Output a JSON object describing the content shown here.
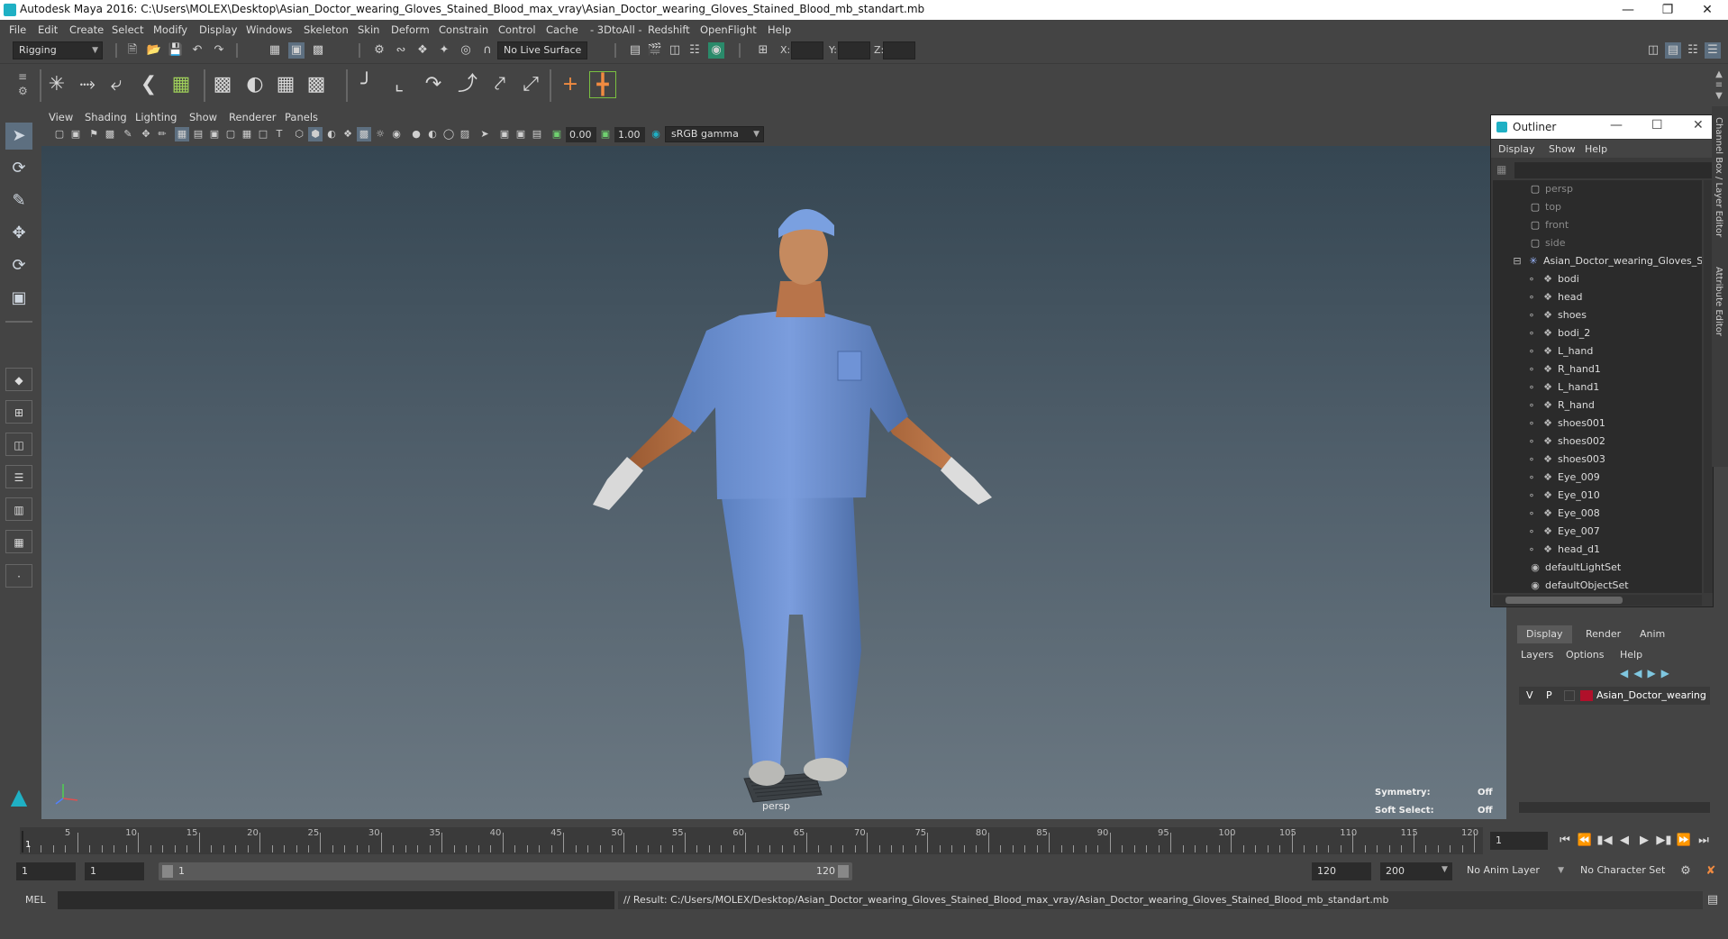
{
  "window": {
    "title": "Autodesk Maya 2016: C:\\Users\\MOLEX\\Desktop\\Asian_Doctor_wearing_Gloves_Stained_Blood_max_vray\\Asian_Doctor_wearing_Gloves_Stained_Blood_mb_standart.mb"
  },
  "menu": [
    "File",
    "Edit",
    "Create",
    "Select",
    "Modify",
    "Display",
    "Windows",
    "Skeleton",
    "Skin",
    "Deform",
    "Constrain",
    "Control",
    "Cache",
    "- 3DtoAll -",
    "Redshift",
    "OpenFlight",
    "Help"
  ],
  "statusline": {
    "menuset": "Rigging",
    "live_surface": "No Live Surface",
    "x_label": "X:",
    "y_label": "Y:",
    "z_label": "Z:"
  },
  "viewport": {
    "menu": [
      "View",
      "Shading",
      "Lighting",
      "Show",
      "Renderer",
      "Panels"
    ],
    "exposure": "0.00",
    "gamma": "1.00",
    "colorspace": "sRGB gamma",
    "camera_label": "persp",
    "hud": {
      "symmetry_label": "Symmetry:",
      "symmetry_value": "Off",
      "softselect_label": "Soft Select:",
      "softselect_value": "Off"
    }
  },
  "outliner": {
    "title": "Outliner",
    "menu": [
      "Display",
      "Show",
      "Help"
    ],
    "cameras": [
      "persp",
      "top",
      "front",
      "side"
    ],
    "group": "Asian_Doctor_wearing_Gloves_St",
    "children": [
      "bodi",
      "head",
      "shoes",
      "bodi_2",
      "L_hand",
      "R_hand1",
      "L_hand1",
      "R_hand",
      "shoes001",
      "shoes002",
      "shoes003",
      "Eye_009",
      "Eye_010",
      "Eye_008",
      "Eye_007",
      "head_d1"
    ],
    "sets": [
      "defaultLightSet",
      "defaultObjectSet"
    ]
  },
  "right_tabs": [
    "Channel Box / Layer Editor",
    "Attribute Editor"
  ],
  "layer_editor": {
    "tabs": [
      "Display",
      "Render",
      "Anim"
    ],
    "menu": [
      "Layers",
      "Options",
      "Help"
    ],
    "layer": {
      "v": "V",
      "p": "P",
      "name": "Asian_Doctor_wearing",
      "color": "#b0102a"
    }
  },
  "timeline": {
    "labels": [
      "5",
      "10",
      "15",
      "20",
      "25",
      "30",
      "35",
      "40",
      "45",
      "50",
      "55",
      "60",
      "65",
      "70",
      "75",
      "80",
      "85",
      "90",
      "95",
      "100",
      "105",
      "110",
      "115",
      "120"
    ],
    "current_frame_marker": "1",
    "current_frame": "1"
  },
  "range": {
    "start": "1",
    "playback_start": "1",
    "slider_start": "1",
    "slider_end": "120",
    "playback_end": "120",
    "end": "200",
    "anim_layer": "No Anim Layer",
    "character_set": "No Character Set"
  },
  "command": {
    "lang": "MEL",
    "result": "// Result: C:/Users/MOLEX/Desktop/Asian_Doctor_wearing_Gloves_Stained_Blood_max_vray/Asian_Doctor_wearing_Gloves_Stained_Blood_mb_standart.mb"
  }
}
